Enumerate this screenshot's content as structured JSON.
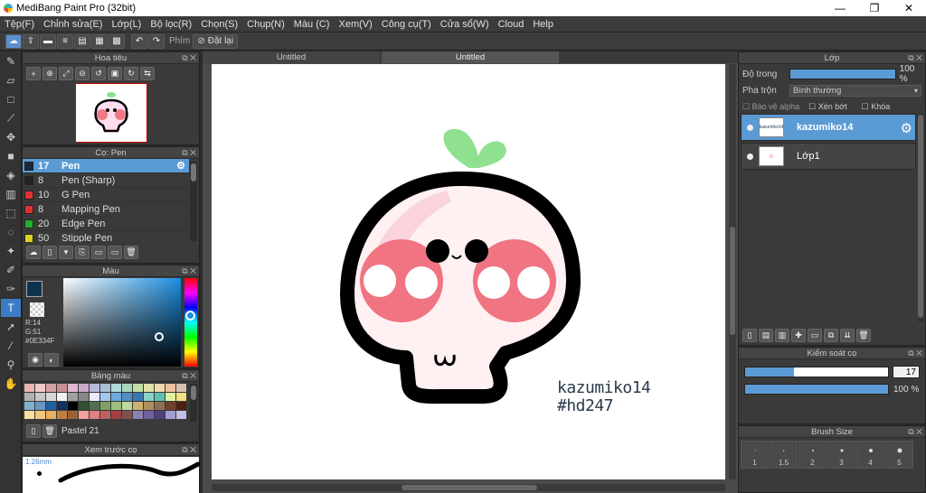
{
  "window": {
    "title": "MediBang Paint Pro (32bit)",
    "minimize": "—",
    "maximize": "❐",
    "close": "✕"
  },
  "menu": [
    "Tệp(F)",
    "Chỉnh sửa(E)",
    "Lớp(L)",
    "Bộ lọc(R)",
    "Chọn(S)",
    "Chụp(N)",
    "Màu (C)",
    "Xem(V)",
    "Công cụ(T)",
    "Cửa sổ(W)",
    "Cloud",
    "Help"
  ],
  "toolbar": {
    "hotkey_label": "Phím",
    "cancel_label": "Đặt lại"
  },
  "navigator": {
    "title": "Hoa tiêu"
  },
  "brush_panel": {
    "title": "Cọ: Pen",
    "items": [
      {
        "size": "17",
        "name": "Pen",
        "color": "#1a2a3a",
        "selected": true
      },
      {
        "size": "8",
        "name": "Pen (Sharp)",
        "color": "#222222"
      },
      {
        "size": "10",
        "name": "G Pen",
        "color": "#e03030"
      },
      {
        "size": "8",
        "name": "Mapping Pen",
        "color": "#e03030"
      },
      {
        "size": "20",
        "name": "Edge Pen",
        "color": "#20b030"
      },
      {
        "size": "50",
        "name": "Stipple Pen",
        "color": "#e0d020"
      }
    ]
  },
  "color_panel": {
    "title": "Màu",
    "r": "R:14",
    "g": "G:51",
    "hex": "#0E334F"
  },
  "palette": {
    "title": "Bảng màu",
    "name": "Pastel 21"
  },
  "brush_preview": {
    "title": "Xem trước cọ",
    "size": "1.26mm"
  },
  "canvas": {
    "tabs": [
      "Untitled",
      "Untitled"
    ],
    "signature_line1": "kazumiko14",
    "signature_line2": "#hd247"
  },
  "layer_panel": {
    "title": "Lớp",
    "opacity_label": "Độ trong",
    "opacity_value": "100 %",
    "opacity_fraction": 1.0,
    "blend_label": "Pha trộn",
    "blend_value": "Bình thường",
    "alpha_protect": "Bảo vệ alpha",
    "clipping": "Xén bớt",
    "lock": "Khóa",
    "layers": [
      {
        "name": "kazumiko14",
        "selected": true,
        "thumb": "kazumiko14"
      },
      {
        "name": "Lớp1",
        "selected": false,
        "thumb": ""
      }
    ]
  },
  "brush_control": {
    "title": "Kiểm soát cọ",
    "size_value": "17",
    "size_fraction": 0.34,
    "opacity_value": "100 %",
    "opacity_fraction": 1.0
  },
  "brush_size": {
    "title": "Brush Size",
    "sizes": [
      "1",
      "1.5",
      "2",
      "3",
      "4",
      "5"
    ]
  }
}
